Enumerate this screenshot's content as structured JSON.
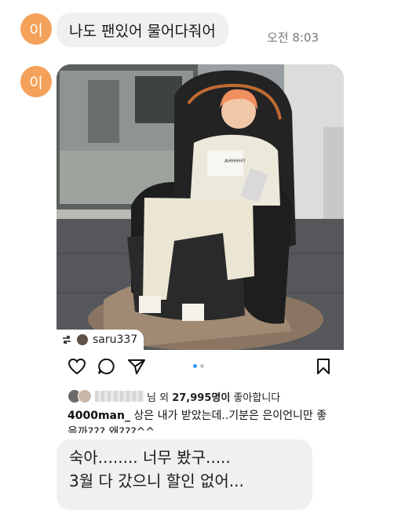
{
  "sender": {
    "initial": "이"
  },
  "messages": [
    {
      "text": "나도 팬있어 물어다줘어",
      "time": "오전 8:03"
    }
  ],
  "shared_post": {
    "repost_user": "saru337",
    "shirt_text": "AHHHH!!",
    "likes_text_prefix": "님 외",
    "likes_count": "27,995명이",
    "likes_text_suffix": "좋아합니다",
    "caption_user": "4000man_",
    "caption_text": "상은 내가 받았는데..기분은 은이언니만 좋을까??? 왜???^^",
    "carousel": {
      "total": 2,
      "active": 1
    }
  },
  "reply": {
    "line1": "숙아........ 너무 봤구.....",
    "line2": "3월 다 갔으니 할인 없어..."
  },
  "colors": {
    "avatar": "#f4a15a",
    "bubble": "#eef0f2",
    "carousel_active": "#3897f0"
  },
  "icons": [
    "heart-icon",
    "comment-icon",
    "share-icon",
    "bookmark-icon",
    "repost-icon"
  ]
}
